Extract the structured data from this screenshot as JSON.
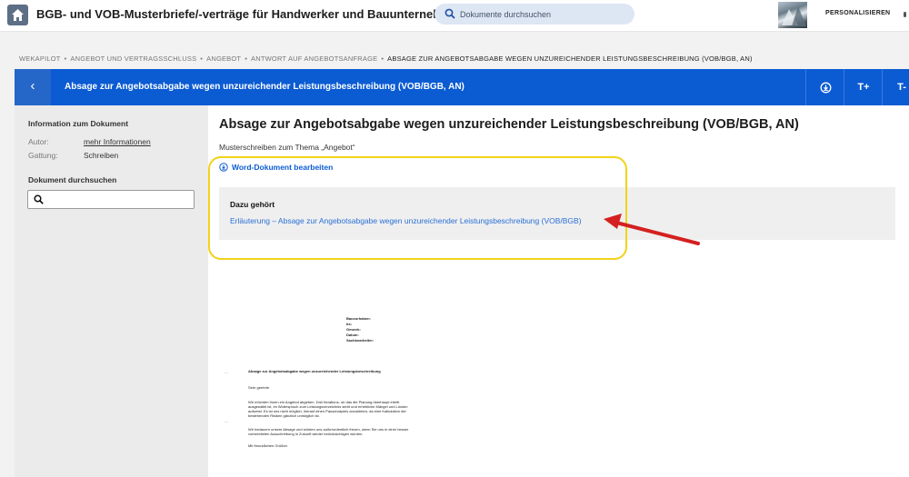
{
  "header": {
    "app_title": "BGB- und VOB-Musterbriefe/-verträge für Handwerker und Bauunternehmer",
    "search_placeholder": "Dokumente durchsuchen",
    "personalize_label": "PERSONALISIEREN"
  },
  "breadcrumb": [
    "WEKAPILOT",
    "ANGEBOT UND VERTRAGSSCHLUSS",
    "ANGEBOT",
    "ANTWORT AUF ANGEBOTSANFRAGE",
    "ABSAGE ZUR ANGEBOTSABGABE WEGEN UNZUREICHENDER LEISTUNGSBESCHREIBUNG (VOB/BGB, AN)"
  ],
  "breadcrumb_separator": "•",
  "titlebar": {
    "back_icon": "‹",
    "title": "Absage zur Angebotsabgabe wegen unzureichender Leistungsbeschreibung (VOB/BGB, AN)",
    "increase_font_label": "T+",
    "decrease_font_label": "T-"
  },
  "sidebar": {
    "info_heading": "Information zum Dokument",
    "rows": [
      {
        "key": "Autor:",
        "value": "mehr Informationen"
      },
      {
        "key": "Gattung:",
        "value": "Schreiben"
      }
    ],
    "search_heading": "Dokument durchsuchen",
    "search_value": ""
  },
  "main": {
    "title": "Absage zur Angebotsabgabe wegen unzureichender Leistungsbeschreibung (VOB/BGB, AN)",
    "subtitle": "Musterschreiben zum Thema „Angebot“",
    "word_link": "Word-Dokument bearbeiten",
    "related_heading": "Dazu gehört",
    "related_link": "Erläuterung – Absage zur Angebotsabgabe wegen unzureichender Leistungsbeschreibung (VOB/BGB)"
  },
  "preview": {
    "meta_labels": [
      "Bauvorhaben:",
      "bs:",
      "Gewerk:",
      "Datum:",
      "Sachbearbeiter:"
    ],
    "heading": "Absage zur Angebotsabgabe wegen unzureichender Leistungsbeschreibung",
    "greeting": "Sehr geehrte",
    "para1": [
      "Wir möchten Ihnen ein Angebot abgeben. Drei Iterations- ob das die Planung überhaupt erteilt",
      "ausgewählt ist, im Widerspruch zum Leistungsverzeichnis steht und erhebliche Mängel und Lücken",
      "aufweist. Es ist uns nicht möglich, hierauf einen Pauschalpreis anzubieten, da eine Kalkulation der",
      "bestehenden Risiken gänzlich unmöglich ist."
    ],
    "para2": [
      "Wir bedauern unsere Absage und würden uns außerordentlich freuen, wenn Sie uns in einer besser",
      "vorbereiteten Ausschreibung in Zukunft wieder berücksichtigen würden."
    ],
    "closing": "Mit freundlichen Grüßen",
    "margin_marks": [
      "....",
      "...."
    ]
  },
  "colors": {
    "brand_blue": "#0b5bd3",
    "highlight_yellow": "#f2d21a",
    "arrow_red": "#d42020"
  },
  "icons": {
    "home": "home-icon",
    "search": "search-icon",
    "download": "download-icon",
    "back": "chevron-left-icon"
  }
}
